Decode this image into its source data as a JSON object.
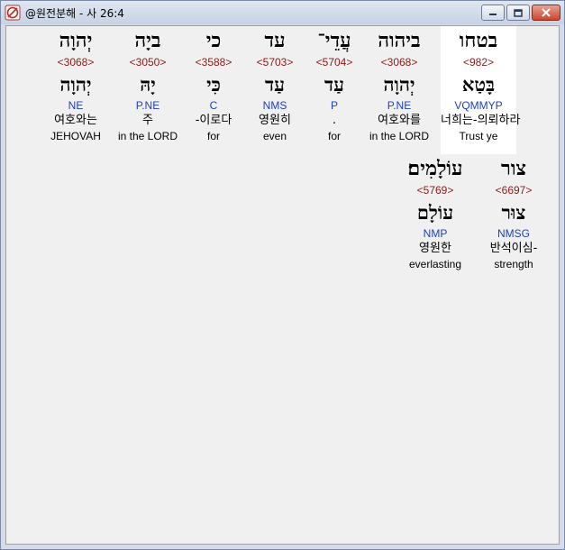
{
  "window": {
    "title": "@원전분해 - 사 26:4",
    "buttons": [
      "minimize",
      "maximize",
      "close"
    ]
  },
  "rows": [
    {
      "words": [
        {
          "word": "בטחו",
          "strong": "<982>",
          "lemma": "בָּטַא",
          "morph": "VQMMYP",
          "korean": "너희는-의뢰하라",
          "english": "Trust ye",
          "highlight": true
        },
        {
          "word": "ביהוה",
          "strong": "<3068>",
          "lemma": "יְהוָה",
          "morph": "P.NE",
          "korean": "여호와를",
          "english": "in the LORD"
        },
        {
          "word": "עֲדֵי־",
          "strong": "<5704>",
          "lemma": "עַד",
          "morph": "P",
          "korean": ".",
          "english": "for"
        },
        {
          "word": "עד",
          "strong": "<5703>",
          "lemma": "עַד",
          "morph": "NMS",
          "korean": "영원히",
          "english": "even"
        },
        {
          "word": "כי",
          "strong": "<3588>",
          "lemma": "כִּי",
          "morph": "C",
          "korean": "-이로다",
          "english": "for"
        },
        {
          "word": "ביָה",
          "strong": "<3050>",
          "lemma": "יָהּ",
          "morph": "P.NE",
          "korean": "주",
          "english": "in the LORD"
        },
        {
          "word": "יְהוָה",
          "strong": "<3068>",
          "lemma": "יְהוָה",
          "morph": "NE",
          "korean": "여호와는",
          "english": "JEHOVAH"
        }
      ]
    },
    {
      "words": [
        {
          "word": "צור",
          "strong": "<6697>",
          "lemma": "צוּר",
          "morph": "NMSG",
          "korean": "반석이심-",
          "english": "strength"
        },
        {
          "word": "עוֹלָמִים׃",
          "strong": "<5769>",
          "lemma": "עוֹלָם",
          "morph": "NMP",
          "korean": "영원한",
          "english": "everlasting"
        }
      ]
    }
  ]
}
